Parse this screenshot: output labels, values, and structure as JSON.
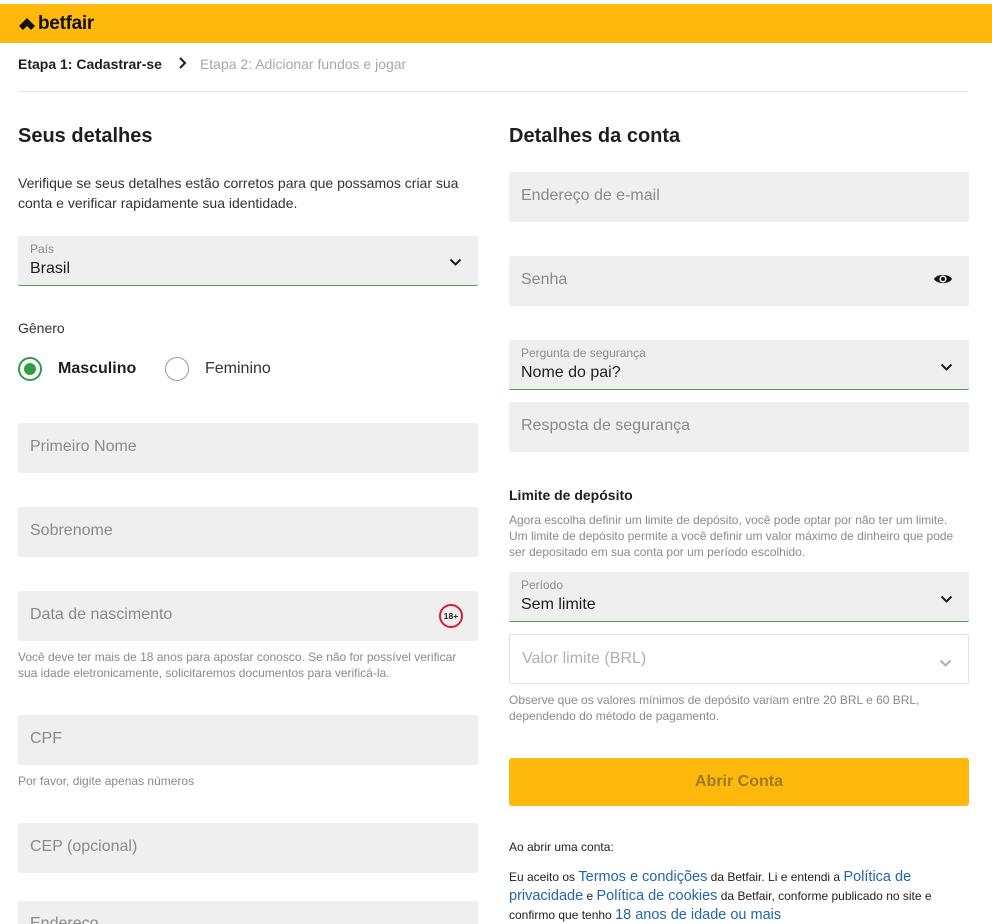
{
  "brand": {
    "name": "betfair"
  },
  "steps": {
    "active": "Etapa 1: Cadastrar-se",
    "inactive": "Etapa 2: Adicionar fundos e jogar"
  },
  "left": {
    "title": "Seus detalhes",
    "intro": "Verifique se seus detalhes estão corretos para que possamos criar sua conta e verificar rapidamente sua identidade.",
    "country": {
      "label": "País",
      "value": "Brasil"
    },
    "gender": {
      "label": "Gênero",
      "options": [
        "Masculino",
        "Feminino"
      ],
      "selected": "Masculino"
    },
    "first_name_placeholder": "Primeiro Nome",
    "last_name_placeholder": "Sobrenome",
    "dob_placeholder": "Data de nascimento",
    "age_badge": "18+",
    "dob_help": "Você deve ter mais de 18 anos para apostar conosco. Se não for possível verificar sua idade eletronicamente, solicitaremos documentos para verificá-la.",
    "cpf_placeholder": "CPF",
    "cpf_help": "Por favor, digite apenas números",
    "cep_placeholder": "CEP (opcional)",
    "address_placeholder": "Endereço"
  },
  "right": {
    "title": "Detalhes da conta",
    "email_placeholder": "Endereço de e-mail",
    "password_placeholder": "Senha",
    "security_question": {
      "label": "Pergunta de segurança",
      "value": "Nome do pai?"
    },
    "security_answer_placeholder": "Resposta de segurança",
    "deposit": {
      "title": "Limite de depósito",
      "description": "Agora escolha definir um limite de depósito, você pode optar por não ter um limite. Um limite de depósito permite a você definir um valor máximo de dinheiro que pode ser depositado em sua conta por um período escolhido.",
      "period": {
        "label": "Período",
        "value": "Sem limite"
      },
      "limit_placeholder": "Valor limite (BRL)",
      "note": "Observe que os valores mínimos de depósito variam entre 20 BRL e 60 BRL, dependendo do método de pagamento."
    },
    "submit_label": "Abrir Conta",
    "terms": {
      "heading": "Ao abrir uma conta:",
      "t1": "Eu aceito os ",
      "link_terms": "Termos e condições",
      "t2": " da Betfair. Li e entendi a ",
      "link_privacy": "Política de privacidade",
      "t3": " e ",
      "link_cookies": "Política de cookies",
      "t4": " da Betfair, conforme publicado no site e confirmo que tenho ",
      "link_age": "18 anos de idade ou mais"
    }
  },
  "colors": {
    "brand_yellow": "#ffb80c",
    "success_green": "#2e9e44",
    "link_blue": "#2366a8",
    "age_red": "#d3202f"
  },
  "icons": [
    "betfair-logo-icon",
    "chevron-right-icon",
    "chevron-down-icon",
    "eye-icon",
    "age-18-badge-icon"
  ]
}
